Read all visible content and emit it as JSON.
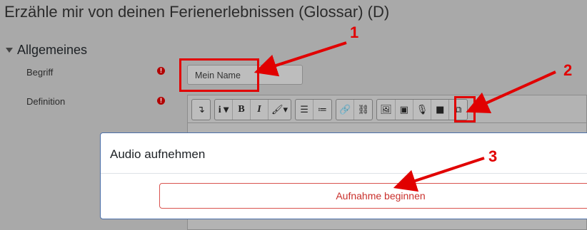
{
  "page": {
    "title": "Erzähle mir von deinen Ferienerlebnissen (Glossar) (D)"
  },
  "section": {
    "label": "Allgemeines"
  },
  "form": {
    "begriff": {
      "label": "Begriff",
      "value": "Mein Name"
    },
    "definition": {
      "label": "Definition"
    },
    "required_icon": "!"
  },
  "toolbar": {
    "groups": [
      [
        {
          "icon": "collapse-icon",
          "glyph": "↴"
        }
      ],
      [
        {
          "icon": "info-style-icon",
          "glyph": "i ▾"
        },
        {
          "icon": "bold-icon",
          "glyph": "B"
        },
        {
          "icon": "italic-icon",
          "glyph": "I"
        },
        {
          "icon": "brush-icon",
          "glyph": "🖌▾"
        }
      ],
      [
        {
          "icon": "unordered-list-icon",
          "glyph": "☰"
        },
        {
          "icon": "ordered-list-icon",
          "glyph": "≔"
        }
      ],
      [
        {
          "icon": "link-icon",
          "glyph": "🔗"
        },
        {
          "icon": "unlink-icon",
          "glyph": "⛓"
        }
      ],
      [
        {
          "icon": "image-icon",
          "glyph": "🖼"
        },
        {
          "icon": "media-icon",
          "glyph": "▣"
        },
        {
          "icon": "microphone-icon",
          "glyph": "🎙"
        },
        {
          "icon": "video-icon",
          "glyph": "■"
        },
        {
          "icon": "copy-icon",
          "glyph": "⧉"
        }
      ]
    ]
  },
  "modal": {
    "title": "Audio aufnehmen",
    "record_button": "Aufnahme beginnen"
  },
  "callouts": {
    "one": "1",
    "two": "2",
    "three": "3"
  },
  "colors": {
    "callout": "#e10000",
    "danger": "#c9302c",
    "required": "#b20000"
  }
}
